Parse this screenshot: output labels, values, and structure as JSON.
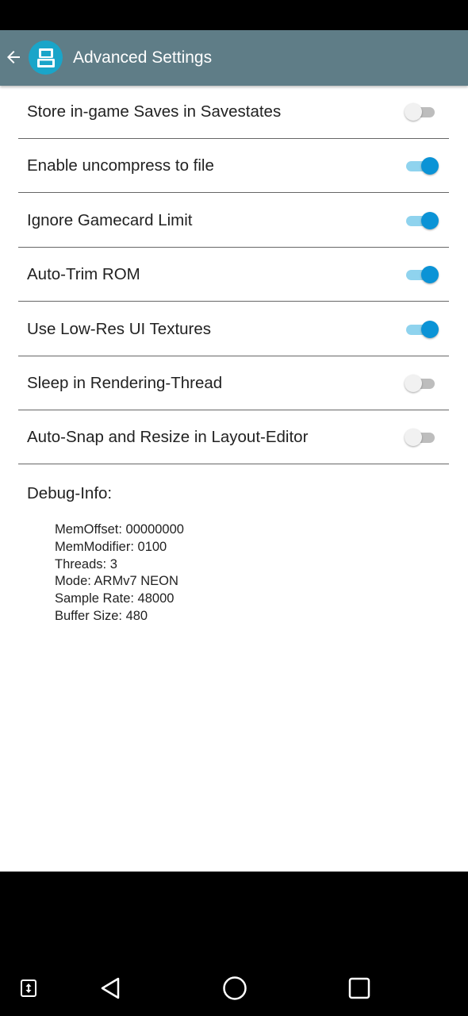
{
  "app_bar": {
    "title": "Advanced Settings",
    "back_icon": "arrow-left-icon",
    "app_icon": "nintendo-ds-icon"
  },
  "settings": [
    {
      "label": "Store in-game Saves in Savestates",
      "enabled": false
    },
    {
      "label": "Enable uncompress to file",
      "enabled": true
    },
    {
      "label": "Ignore Gamecard Limit",
      "enabled": true
    },
    {
      "label": "Auto-Trim ROM",
      "enabled": true
    },
    {
      "label": "Use Low-Res UI Textures",
      "enabled": true
    },
    {
      "label": "Sleep in Rendering-Thread",
      "enabled": false
    },
    {
      "label": "Auto-Snap and Resize in Layout-Editor",
      "enabled": false
    }
  ],
  "debug": {
    "title": "Debug-Info:",
    "lines": [
      "MemOffset: 00000000",
      "MemModifier: 0100",
      "Threads: 3",
      "Mode: ARMv7 NEON",
      "Sample Rate: 48000",
      "Buffer Size: 480"
    ]
  },
  "nav_bar": {
    "icons": [
      "screen-rotate-icon",
      "back-triangle-icon",
      "home-circle-icon",
      "recents-square-icon"
    ]
  },
  "colors": {
    "app_bar": "#5f7d87",
    "accent": "#0b93d6",
    "accent_track": "#8fd3ee",
    "app_icon": "#1aa5c9"
  }
}
